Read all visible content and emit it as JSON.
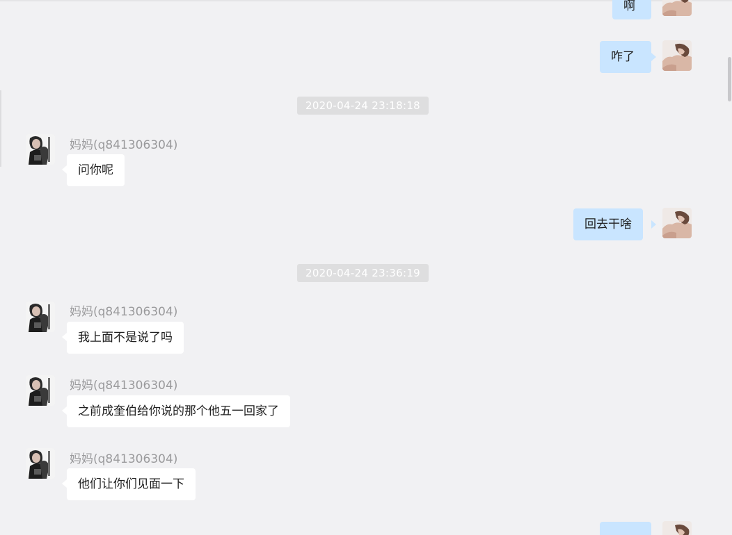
{
  "timestamps": [
    "2020-04-24 23:18:18",
    "2020-04-24 23:36:19"
  ],
  "contact": {
    "name": "妈妈(q841306304)"
  },
  "messages": {
    "out_top_partial": "啊",
    "out_1": "咋了",
    "in_1": "问你呢",
    "out_2": "回去干啥",
    "in_2": "我上面不是说了吗",
    "in_3": "之前成奎伯给你说的那个他五一回家了",
    "in_4": "他们让你们见面一下"
  },
  "colors": {
    "background": "#f1f1f3",
    "incoming_bubble": "#ffffff",
    "outgoing_bubble": "#c9e5ff",
    "timestamp_pill": "#dededf",
    "name_text": "#9a9a9c"
  },
  "icons": {
    "contact_avatar": "woman-photo-avatar",
    "self_avatar": "shoulder-photo-avatar"
  }
}
